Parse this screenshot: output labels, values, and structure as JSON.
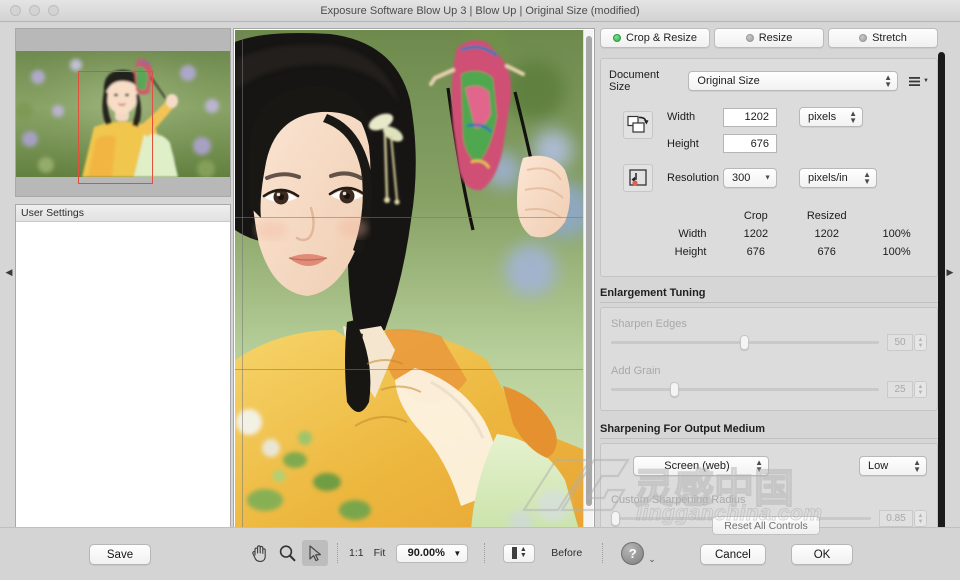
{
  "window": {
    "title": "Exposure Software Blow Up 3 | Blow Up | Original Size (modified)",
    "traffic_lights": [
      "close",
      "minimize",
      "zoom"
    ]
  },
  "left": {
    "navigator": {
      "name": "navigator-preview",
      "crop_rect_color": "#e0503c"
    },
    "settings_panel_title": "User Settings"
  },
  "center": {
    "image_alt": "Woman in yellow hanfu holding a shadow puppet",
    "zoom_guides": true
  },
  "right": {
    "mode_tabs": [
      {
        "label": "Crop & Resize",
        "active": true
      },
      {
        "label": "Resize",
        "active": false
      },
      {
        "label": "Stretch",
        "active": false
      }
    ],
    "document_size": {
      "label": "Document Size",
      "value": "Original Size",
      "menu_icon": "hamburger-menu-icon"
    },
    "dimensions": {
      "link_icon": "link-dimensions-icon",
      "resolution_icon": "resolution-lock-icon",
      "width_label": "Width",
      "width_value": "1202",
      "height_label": "Height",
      "height_value": "676",
      "units_value": "pixels",
      "resolution_label": "Resolution",
      "resolution_value": "300",
      "resolution_units": "pixels/in"
    },
    "summary": {
      "headers": [
        "",
        "Crop",
        "Resized",
        ""
      ],
      "rows": [
        {
          "label": "Width",
          "crop": "1202",
          "resized": "1202",
          "percent": "100%"
        },
        {
          "label": "Height",
          "crop": "676",
          "resized": "676",
          "percent": "100%"
        }
      ]
    },
    "enlargement_tuning": {
      "title": "Enlargement Tuning",
      "enabled": false,
      "sliders": [
        {
          "label": "Sharpen Edges",
          "value": "50",
          "position_pct": 50
        },
        {
          "label": "Add Grain",
          "value": "25",
          "position_pct": 22
        }
      ]
    },
    "sharpening": {
      "title": "Sharpening For Output Medium",
      "medium_value": "Screen (web)",
      "amount_value": "Low",
      "radius_label": "Custom Sharpening Radius",
      "radius_value": "0.85",
      "radius_position_pct": 1,
      "radius_enabled": false
    }
  },
  "bottom": {
    "save_label": "Save",
    "reset_label": "Reset All Controls",
    "cancel_label": "Cancel",
    "ok_label": "OK",
    "tools": [
      {
        "name": "hand-tool",
        "icon": "hand-icon",
        "selected": false
      },
      {
        "name": "zoom-tool",
        "icon": "magnifier-icon",
        "selected": false
      },
      {
        "name": "pointer-tool",
        "icon": "arrow-cursor-icon",
        "selected": true
      }
    ],
    "one_to_one_label": "1:1",
    "fit_label": "Fit",
    "zoom_value": "90.00%",
    "before_label": "Before",
    "help_icon": "question-mark-icon"
  },
  "watermark": {
    "text": "lingganchina.com",
    "cn_text": "灵感中国"
  }
}
